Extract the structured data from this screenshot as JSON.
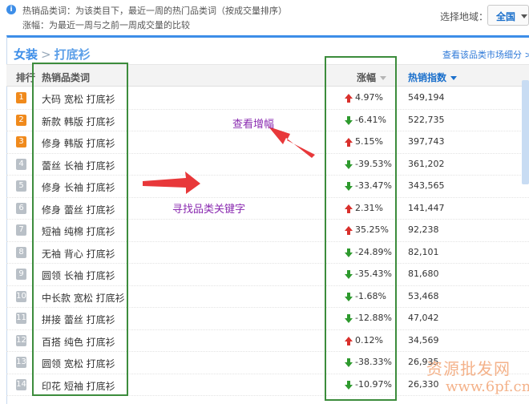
{
  "top": {
    "info_line1": "热销品类词：为该类目下，最近一周的热门品类词（按成交量排序）",
    "info_line2": "涨幅：为最近一周与之前一周成交量的比较",
    "region_label": "选择地域：",
    "region_value": "全国"
  },
  "panel": {
    "crumb_main": "女装",
    "crumb_sep": ">",
    "crumb_sub": "打底衫",
    "view_link": "查看该品类市场细分 >"
  },
  "table": {
    "headers": {
      "rank": "排行",
      "word": "热销品类词",
      "growth": "涨幅",
      "index": "热销指数"
    },
    "rows": [
      {
        "rank": "1",
        "word": "大码 宽松 打底衫",
        "dir": "up",
        "growth": "4.97%",
        "index": "549,194"
      },
      {
        "rank": "2",
        "word": "新款 韩版 打底衫",
        "dir": "down",
        "growth": "-6.41%",
        "index": "522,735"
      },
      {
        "rank": "3",
        "word": "修身 韩版 打底衫",
        "dir": "up",
        "growth": "5.15%",
        "index": "397,743"
      },
      {
        "rank": "4",
        "word": "蕾丝 长袖 打底衫",
        "dir": "down",
        "growth": "-39.53%",
        "index": "361,202"
      },
      {
        "rank": "5",
        "word": "修身 长袖 打底衫",
        "dir": "down",
        "growth": "-33.47%",
        "index": "343,565"
      },
      {
        "rank": "6",
        "word": "修身 蕾丝 打底衫",
        "dir": "up",
        "growth": "2.31%",
        "index": "141,447"
      },
      {
        "rank": "7",
        "word": "短袖 纯棉 打底衫",
        "dir": "up",
        "growth": "35.25%",
        "index": "92,238"
      },
      {
        "rank": "8",
        "word": "无袖 背心 打底衫",
        "dir": "down",
        "growth": "-24.89%",
        "index": "82,101"
      },
      {
        "rank": "9",
        "word": "圆领 长袖 打底衫",
        "dir": "down",
        "growth": "-35.43%",
        "index": "81,680"
      },
      {
        "rank": "10",
        "word": "中长款 宽松 打底衫",
        "dir": "down",
        "growth": "-1.68%",
        "index": "53,468"
      },
      {
        "rank": "11",
        "word": "拼接 蕾丝 打底衫",
        "dir": "down",
        "growth": "-12.88%",
        "index": "47,042"
      },
      {
        "rank": "12",
        "word": "百搭 纯色 打底衫",
        "dir": "up",
        "growth": "0.12%",
        "index": "34,569"
      },
      {
        "rank": "13",
        "word": "圆领 宽松 打底衫",
        "dir": "down",
        "growth": "-38.33%",
        "index": "26,935"
      },
      {
        "rank": "14",
        "word": "印花 短袖 打底衫",
        "dir": "down",
        "growth": "-10.97%",
        "index": "26,330"
      }
    ]
  },
  "annotations": {
    "view_growth": "查看增幅",
    "find_keywords": "寻找品类关键字"
  },
  "watermark": {
    "line1": "资源批发网",
    "line2": "www.6pf.cn"
  },
  "colors": {
    "accent": "#3d8ee8",
    "up_arrow": "#d9302c",
    "down_arrow": "#2e9a2e",
    "highlight_box": "#3c8c3c",
    "annotation_arrow": "#e8383a",
    "annotation_text": "#8a2bb0"
  }
}
